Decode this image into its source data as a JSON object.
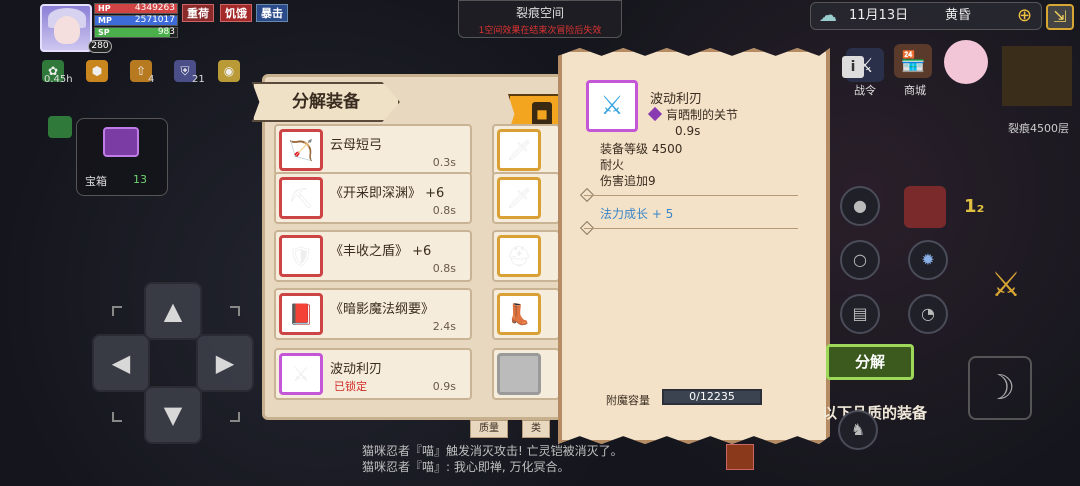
{
  "hud": {
    "level": "280",
    "hp": {
      "label": "HP",
      "value": "4349263",
      "fill": 1.0,
      "color": "#d24444"
    },
    "mp": {
      "label": "MP",
      "value": "2571017",
      "fill": 1.0,
      "color": "#3d6bd8"
    },
    "sp": {
      "label": "SP",
      "value": "983",
      "fill": 0.92,
      "color": "#4bb04b"
    },
    "tags": [
      "重荷",
      "饥饿",
      "暴击"
    ],
    "buffs": [
      {
        "icon": "herb-icon",
        "glyph": "✿",
        "color": "#2f7a3a",
        "count": "0.45h"
      },
      {
        "icon": "hexagon-icon",
        "glyph": "⬢",
        "color": "#c9861f",
        "count": ""
      },
      {
        "icon": "arrow-up-icon",
        "glyph": "⇧",
        "color": "#b87a20",
        "count": "4"
      },
      {
        "icon": "shield-buff-icon",
        "glyph": "⛨",
        "color": "#4a4f8a",
        "count": "21"
      },
      {
        "icon": "coin-icon",
        "glyph": "◉",
        "color": "#b99a36",
        "count": ""
      }
    ]
  },
  "rift": {
    "title": "裂痕空间",
    "warning": "1空间效果在结束次冒险后失效"
  },
  "datebar": {
    "date": "11月13日",
    "time_of_day": "黄昏"
  },
  "top_icons": [
    {
      "name": "battle-pass-icon",
      "glyph": "⚔",
      "caption": "战令"
    },
    {
      "name": "shop-icon",
      "glyph": "🏪",
      "caption": "商城"
    }
  ],
  "rift_floor": "裂痕4500层",
  "chest": {
    "label": "宝箱",
    "count": "13"
  },
  "decompose": {
    "title": "分解装备",
    "items_left": [
      {
        "name": "云母短弓",
        "time": "0.3s",
        "glyph": "🏹",
        "frame": "red",
        "locked": ""
      },
      {
        "name": "《开采即深渊》 +6",
        "time": "0.8s",
        "glyph": "⛏",
        "frame": "red",
        "locked": ""
      },
      {
        "name": "《丰收之盾》 +6",
        "time": "0.8s",
        "glyph": "🛡",
        "frame": "red",
        "locked": ""
      },
      {
        "name": "《暗影魔法纲要》",
        "time": "2.4s",
        "glyph": "📕",
        "frame": "red",
        "locked": ""
      },
      {
        "name": "波动利刃",
        "time": "0.9s",
        "glyph": "⚔",
        "frame": "purple",
        "locked": "已锁定"
      }
    ],
    "items_right_glyphs": [
      "🗡",
      "🗡",
      "⛑",
      "👢",
      ""
    ],
    "bottom_tabs": [
      "质量",
      "类"
    ]
  },
  "tooltip": {
    "name": "波动利刃",
    "socket": "肓晒制的关节",
    "speed": "0.9s",
    "stats": [
      "装备等级 4500",
      "耐火",
      "伤害追加9"
    ],
    "bonus": "法力成长 + 5",
    "capacity_label": "附魔容量",
    "capacity_value": "0/12235"
  },
  "actions": {
    "decompose_label": "分解",
    "quality_text": "以下品质的装备"
  },
  "log": [
    "猫咪忍者『喵』触发消灭攻击! 亡灵铠被消灭了。",
    "猫咪忍者『喵』: 我心即禅, 万化冥合。"
  ]
}
